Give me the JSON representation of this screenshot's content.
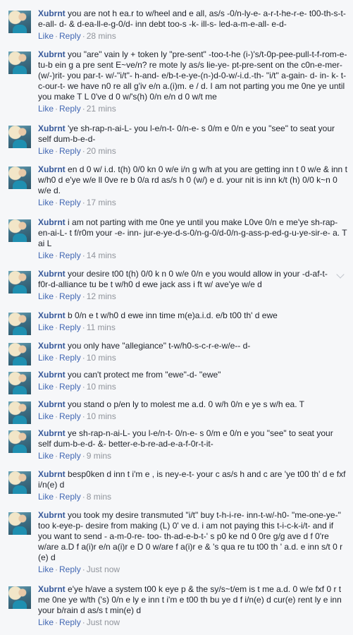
{
  "comments": [
    {
      "author": "Xubrnt",
      "text": "you are not h ea.r to w/heel and e all, as/s -0/n-ly-e- a-r-t-he-r-e- t00-th-s-t-e-all- d- & d-ea-ll-e-g-0/d- inn debt too-s -k- ill-s- led-a-m-e-all- e-d-",
      "like": "Like",
      "reply": "Reply",
      "time": "28 mins"
    },
    {
      "author": "Xubrnt",
      "text": "you \"are\" vain ly + token ly \"pre-sent\" -too-t-he (i-)'s/t-0p-pee-pull-t-f-rom-e-tu-b ein g a pre sent E~ve/n? re mote ly as/s lie-ye- pt-pre-sent on the c0n-e-mer-(w/-)rit- you par-t- w/-\"i/t\"- h-and- e/b-t-e-ye-(n-)d-0-w/-i.d.-th- \"i/t\" a-gain- d- in- k- t- c-our-t- we have n0 re all g'iv e/n a.(i)m. e / d. I am not parting you me 0ne ye until you make T L 0've d 0 w/'s(h) 0/n e/n d 0 w/t me",
      "like": "Like",
      "reply": "Reply",
      "time": "21 mins"
    },
    {
      "author": "Xubrnt",
      "text": "'ye sh-rap-n-ai-L- you l-e/n-t- 0/n-e- s 0/m e 0/n e you \"see\" to seat your self dum-b-e-d-",
      "like": "Like",
      "reply": "Reply",
      "time": "20 mins"
    },
    {
      "author": "Xubrnt",
      "text": "en d 0 w/ i.d. t(h) 0/0 kn 0 w/e i/n g w/h at you are getting inn t 0 w/e & inn t w/h0 d e'ye w/e ll 0ve re b 0/a rd as/s h 0 (w/) e d. your nit is inn k/t (h) 0/0 k~n 0 w/e d.",
      "like": "Like",
      "reply": "Reply",
      "time": "17 mins"
    },
    {
      "author": "Xubrnt",
      "text": "i am not parting with me 0ne ye until you make L0ve 0/n e me'ye sh-rap-en-ai-L- t f/r0m your -e- inn- jur-e-ye-d-s-0/n-g-0/d-0/n-g-ass-p-ed-g-u-ye-sir-e- a. T ai L",
      "like": "Like",
      "reply": "Reply",
      "time": "14 mins"
    },
    {
      "author": "Xubrnt",
      "text": "your desire t00 t(h) 0/0 k n 0 w/e 0/n e you would allow in your -d-af-t-f0r-d-alliance tu be t w/h0 d ewe jack ass i ft w/ ave'ye w/e d",
      "like": "Like",
      "reply": "Reply",
      "time": "12 mins",
      "chevron": true
    },
    {
      "author": "Xubrnt",
      "text": "b 0/n e t w/h0 d ewe inn time m(e)a.i.d. e/b t00 th' d ewe",
      "like": "Like",
      "reply": "Reply",
      "time": "11 mins"
    },
    {
      "author": "Xubrnt",
      "text": "you only have \"allegiance\" t-w/h0-s-c-r-e-w/e-- d-",
      "like": "Like",
      "reply": "Reply",
      "time": "10 mins"
    },
    {
      "author": "Xubrnt",
      "text": "you can't protect me from \"ewe\"-d- \"ewe\"",
      "like": "Like",
      "reply": "Reply",
      "time": "10 mins"
    },
    {
      "author": "Xubrnt",
      "text": "you stand o p/en ly to molest me a.d. 0 w/h 0/n e ye s w/h ea. T",
      "like": "Like",
      "reply": "Reply",
      "time": "10 mins"
    },
    {
      "author": "Xubrnt",
      "text": "ye sh-rap-n-ai-L- you l-e/n-t- 0/n-e- s 0/m e 0/n e you \"see\" to seat your self dum-b-e-d- &- better-e-b-re-ad-e-a-f-0r-t-it-",
      "like": "Like",
      "reply": "Reply",
      "time": "9 mins"
    },
    {
      "author": "Xubrnt",
      "text": "besp0ken d inn t i'm e , is ney-e-t- your c as/s h and c are 'ye t00 th' d e fxf i/n(e) d",
      "like": "Like",
      "reply": "Reply",
      "time": "8 mins"
    },
    {
      "author": "Xubrnt",
      "text": "you took my desire transmuted \"i/t\" buy t-h-i-re- inn-t-w/-h0- \"me-one-ye-\" too k-eye-p- desire from making (L) 0' ve d. i am not paying this t-i-c-k-i/t- and if you want to send - a-m-0-re- too- th-ad-e-b-t-' s p0 ke nd 0 0re g/g ave d f 0're w/are a.D f a(i)r e/n a(i)r e D 0 w/are f a(i)r e & 's qua re tu t00 th ' a.d. e inn s/t 0 r (e) d",
      "like": "Like",
      "reply": "Reply",
      "time": "Just now"
    },
    {
      "author": "Xubrnt",
      "text": "e'ye h/ave a system t00 k eye p & the sy/s~t/em is t me a.d. 0 w/e fxf 0 r t me 0ne ye w/th ('s) 0/n e ly e inn t i'm e t00 th bu ye d f i/n(e) d cur(e) rent ly e inn your b/rain d as/s t min(e) d",
      "like": "Like",
      "reply": "Reply",
      "time": "Just now"
    }
  ]
}
